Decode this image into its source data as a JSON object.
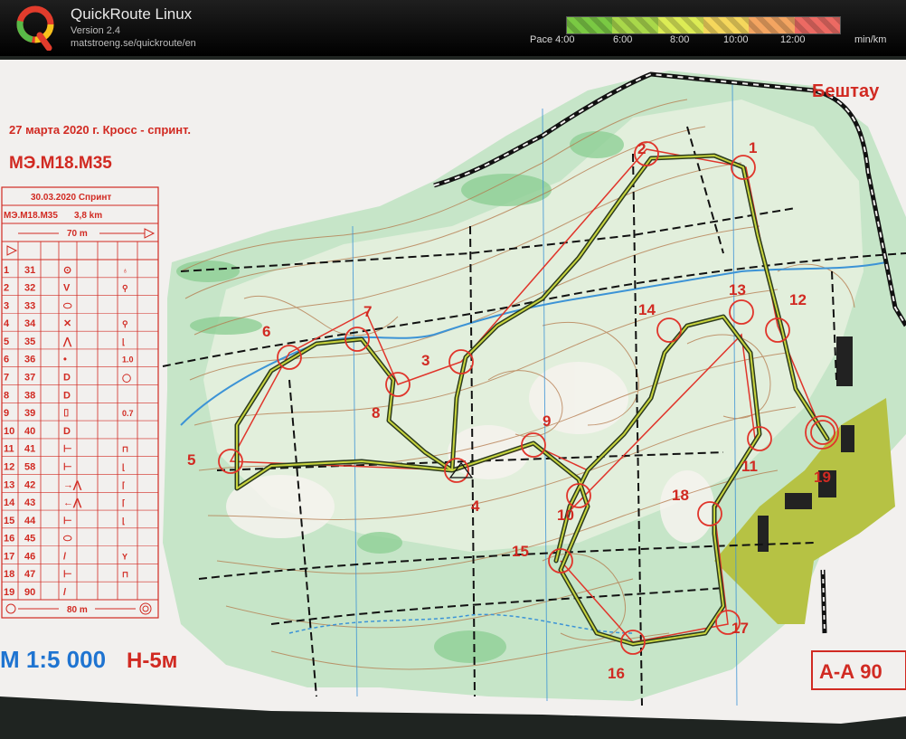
{
  "app": {
    "title": "QuickRoute Linux",
    "version": "Version 2.4",
    "url": "matstroeng.se/quickroute/en"
  },
  "pace_scale": {
    "labels": [
      "Pace 4:00",
      "6:00",
      "8:00",
      "10:00",
      "12:00"
    ],
    "unit": "min/km",
    "colors": [
      "#7ac943",
      "#a9d84a",
      "#dcec55",
      "#f5d75c",
      "#f4a561",
      "#ec6a63"
    ]
  },
  "map": {
    "event_title": "27 марта 2020 г. Кросс - спринт.",
    "class_title": "МЭ.М18.М35",
    "area_name": "Бештау",
    "scale_text": "М 1:5 000",
    "contour_text": "Н-5м",
    "grid_label": "А-А 90",
    "control_description": {
      "header_date": "30.03.2020 Спринт",
      "header_class": "МЭ.М18.М35",
      "header_length": "3,8 km",
      "start_distance": "70 m",
      "finish_distance": "80 m",
      "rows": [
        {
          "n": "1",
          "code": "31",
          "sym": "⊙",
          "extra": "♁"
        },
        {
          "n": "2",
          "code": "32",
          "sym": "V",
          "extra": "⚲"
        },
        {
          "n": "3",
          "code": "33",
          "sym": "⬭",
          "extra": ""
        },
        {
          "n": "4",
          "code": "34",
          "sym": "✕",
          "extra": "⚲"
        },
        {
          "n": "5",
          "code": "35",
          "sym": "⋀",
          "extra": "⌊"
        },
        {
          "n": "6",
          "code": "36",
          "sym": "•",
          "extra": "1.0"
        },
        {
          "n": "7",
          "code": "37",
          "sym": "D",
          "extra": "◯"
        },
        {
          "n": "8",
          "code": "38",
          "sym": "D",
          "extra": ""
        },
        {
          "n": "9",
          "code": "39",
          "sym": "⌷",
          "extra": "0.7"
        },
        {
          "n": "10",
          "code": "40",
          "sym": "D",
          "extra": ""
        },
        {
          "n": "11",
          "code": "41",
          "sym": "⊢",
          "extra": "⊓"
        },
        {
          "n": "12",
          "code": "58",
          "sym": "⊢",
          "extra": "⌊"
        },
        {
          "n": "13",
          "code": "42",
          "sym": "→⋀",
          "extra": "⌈"
        },
        {
          "n": "14",
          "code": "43",
          "sym": "←⋀",
          "extra": "⌈"
        },
        {
          "n": "15",
          "code": "44",
          "sym": "⊢",
          "extra": "⌊"
        },
        {
          "n": "16",
          "code": "45",
          "sym": "⬭",
          "extra": ""
        },
        {
          "n": "17",
          "code": "46",
          "sym": "/",
          "extra": "Y"
        },
        {
          "n": "18",
          "code": "47",
          "sym": "⊢",
          "extra": "⊓"
        },
        {
          "n": "19",
          "code": "90",
          "sym": "/",
          "extra": ""
        }
      ]
    },
    "controls": [
      {
        "n": "1"
      },
      {
        "n": "2"
      },
      {
        "n": "3"
      },
      {
        "n": "4"
      },
      {
        "n": "5"
      },
      {
        "n": "6"
      },
      {
        "n": "7"
      },
      {
        "n": "8"
      },
      {
        "n": "9"
      },
      {
        "n": "10"
      },
      {
        "n": "11"
      },
      {
        "n": "12"
      },
      {
        "n": "13"
      },
      {
        "n": "14"
      },
      {
        "n": "15"
      },
      {
        "n": "16"
      },
      {
        "n": "17"
      },
      {
        "n": "18"
      },
      {
        "n": "19"
      }
    ]
  }
}
